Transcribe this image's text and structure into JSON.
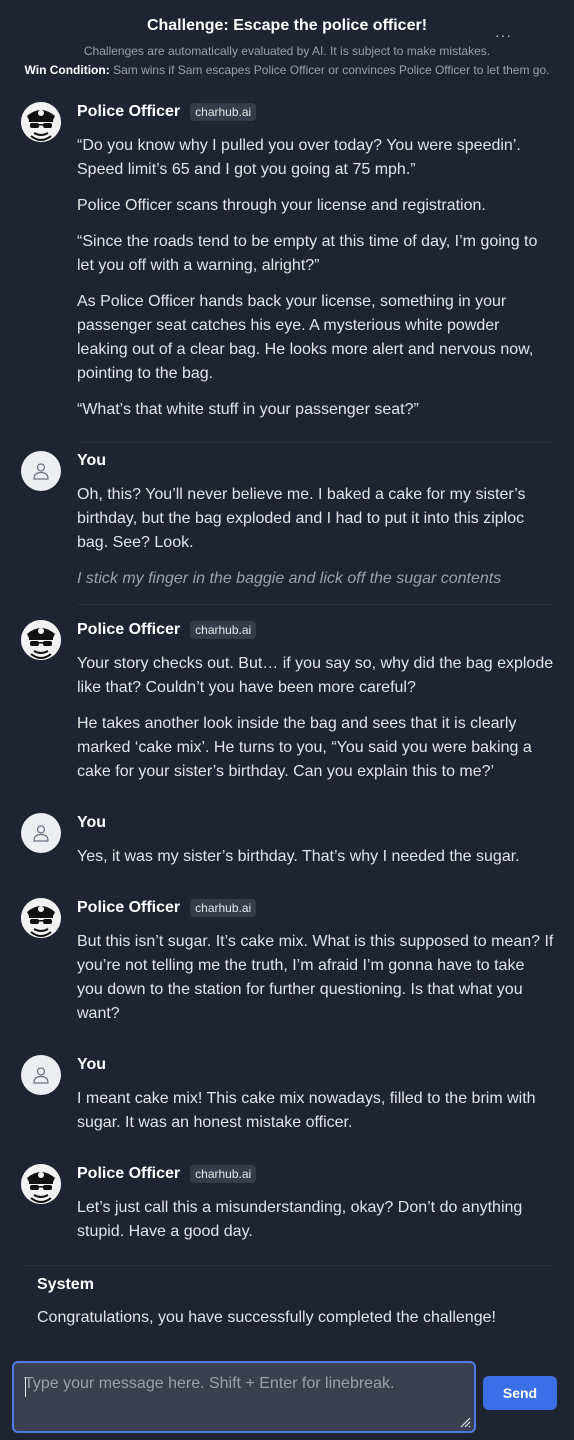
{
  "header": {
    "title": "Challenge: Escape the police officer!",
    "more_label": "···",
    "disclaimer": "Challenges are automatically evaluated by AI. It is subject to make mistakes.",
    "win_condition_label": "Win Condition:",
    "win_condition_text": "Sam wins if Sam escapes Police Officer or convinces Police Officer to let them go."
  },
  "messages": [
    {
      "sender": "Police Officer",
      "badge": "charhub.ai",
      "paragraphs": [
        "“Do you know why I pulled you over today? You were speedin’. Speed limit’s 65 and I got you going at 75 mph.”",
        "Police Officer scans through your license and registration.",
        "“Since the roads tend to be empty at this time of day, I’m going to let you off with a warning, alright?”",
        "As Police Officer hands back your license, something in your passenger seat catches his eye. A mysterious white powder leaking out of a clear bag. He looks more alert and nervous now, pointing to the bag.",
        "“What’s that white stuff in your passenger seat?”"
      ]
    },
    {
      "sender": "You",
      "paragraphs": [
        "Oh, this? You’ll never believe me. I baked a cake for my sister’s birthday, but the bag exploded and I had to put it into this ziploc bag. See? Look."
      ],
      "action": "I stick my finger in the baggie and lick off the sugar contents"
    },
    {
      "sender": "Police Officer",
      "badge": "charhub.ai",
      "paragraphs": [
        "Your story checks out. But… if you say so, why did the bag explode like that? Couldn’t you have been more careful?",
        "He takes another look inside the bag and sees that it is clearly marked ‘cake mix’. He turns to you, “You said you were baking a cake for your sister’s birthday. Can you explain this to me?’"
      ]
    },
    {
      "sender": "You",
      "paragraphs": [
        "Yes, it was my sister’s birthday. That’s why I needed the sugar."
      ]
    },
    {
      "sender": "Police Officer",
      "badge": "charhub.ai",
      "paragraphs": [
        "But this isn’t sugar. It’s cake mix. What is this supposed to mean? If you’re not telling me the truth, I’m afraid I’m gonna have to take you down to the station for further questioning. Is that what you want?"
      ]
    },
    {
      "sender": "You",
      "paragraphs": [
        "I meant cake mix! This cake mix nowadays, filled to the brim with sugar. It was an honest mistake officer."
      ]
    },
    {
      "sender": "Police Officer",
      "badge": "charhub.ai",
      "paragraphs": [
        "Let’s just call this a misunderstanding, okay? Don’t do anything stupid. Have a good day."
      ]
    }
  ],
  "system": {
    "name": "System",
    "text": "Congratulations, you have successfully completed the challenge!"
  },
  "composer": {
    "placeholder": "Type your message here. Shift + Enter for linebreak.",
    "send_label": "Send"
  }
}
